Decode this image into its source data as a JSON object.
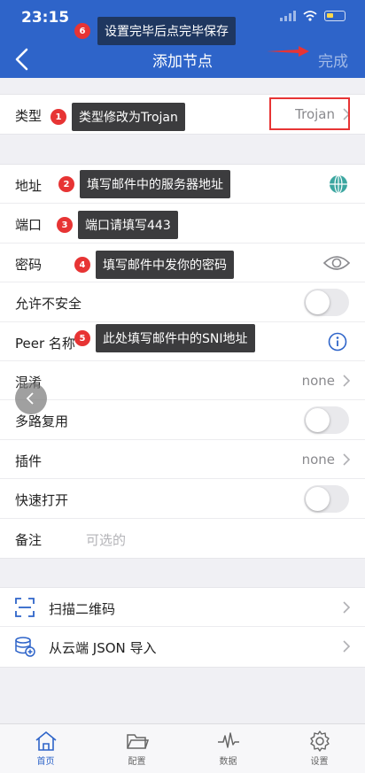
{
  "status_bar": {
    "time": "23:15"
  },
  "header": {
    "title": "添加节点",
    "done_label": "完成"
  },
  "type_row": {
    "label": "类型",
    "value": "Trojan"
  },
  "form": {
    "address_label": "地址",
    "port_label": "端口",
    "password_label": "密码",
    "allow_insecure_label": "允许不安全",
    "peer_name_label": "Peer 名称",
    "obfs_label": "混淆",
    "obfs_value": "none",
    "mux_label": "多路复用",
    "plugin_label": "插件",
    "plugin_value": "none",
    "fast_open_label": "快速打开",
    "remark_label": "备注",
    "remark_placeholder": "可选的"
  },
  "import": {
    "scan_qr_label": "扫描二维码",
    "cloud_json_label": "从云端 JSON 导入"
  },
  "annotations": [
    {
      "num": "1",
      "text": "类型修改为Trojan"
    },
    {
      "num": "2",
      "text": "填写邮件中的服务器地址"
    },
    {
      "num": "3",
      "text": "端口请填写443"
    },
    {
      "num": "4",
      "text": "填写邮件中发你的密码"
    },
    {
      "num": "5",
      "text": "此处填写邮件中的SNI地址"
    },
    {
      "num": "6",
      "text": "设置完毕后点完毕保存"
    }
  ],
  "tabbar": {
    "items": [
      {
        "label": "首页",
        "icon": "home-icon"
      },
      {
        "label": "配置",
        "icon": "folder-icon"
      },
      {
        "label": "数据",
        "icon": "pulse-icon"
      },
      {
        "label": "设置",
        "icon": "gear-icon"
      }
    ]
  },
  "colors": {
    "header": "#2e64c9",
    "annotation_number": "#e73434",
    "highlight": "#e73434",
    "note_bg": "#3c3c3e"
  }
}
